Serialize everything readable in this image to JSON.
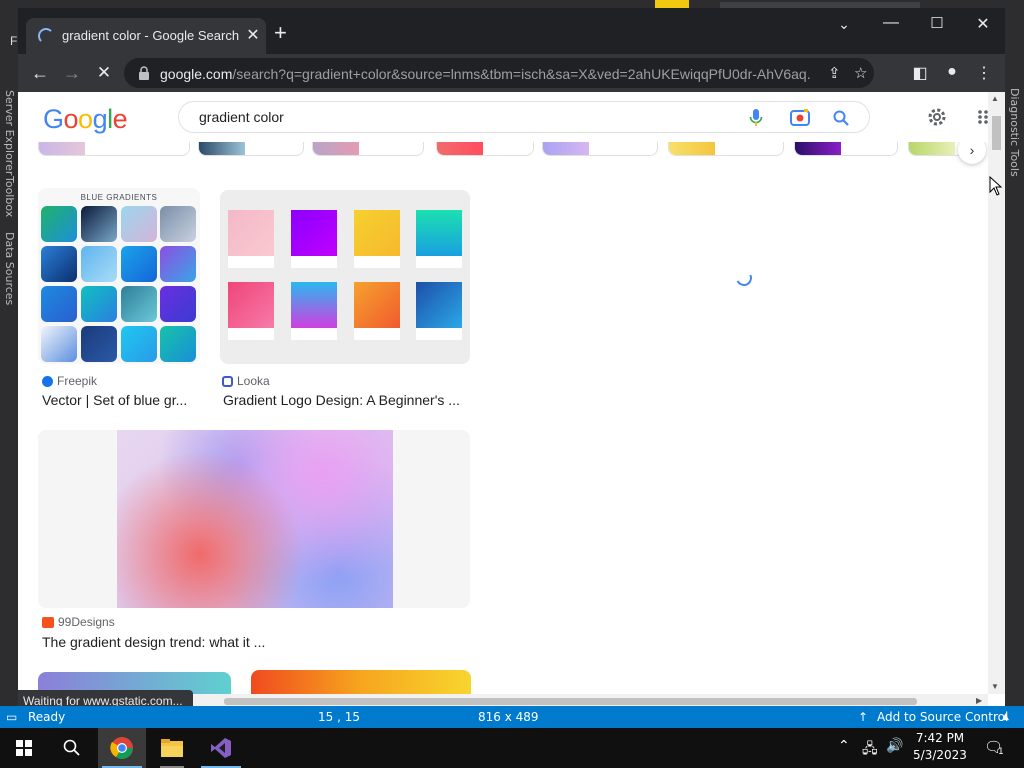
{
  "browser": {
    "tab_title": "gradient color - Google Search",
    "url_host": "google.com",
    "url_path": "/search?q=gradient+color&source=lnms&tbm=isch&sa=X&ved=2ahUKEwiqqPfU0dr-AhV6aq...",
    "status_text": "Waiting for www.gstatic.com..."
  },
  "google": {
    "logo_letters": [
      "G",
      "o",
      "o",
      "g",
      "l",
      "e"
    ],
    "logo_colors": [
      "#4285f4",
      "#ea4335",
      "#fbbc05",
      "#4285f4",
      "#34a853",
      "#ea4335"
    ],
    "search_query": "gradient color"
  },
  "results": [
    {
      "source": "Freepik",
      "caption": "Vector | Set of blue gr...",
      "image_heading": "BLUE GRADIENTS"
    },
    {
      "source": "Looka",
      "caption": "Gradient Logo Design: A Beginner's ..."
    },
    {
      "source": "99Designs",
      "caption": "The gradient design trend: what it ..."
    }
  ],
  "vs_status": {
    "ready": "Ready",
    "position": "15 , 15",
    "size": "816 x 489",
    "source_control": "Add to Source Control"
  },
  "vs_side_left": [
    "Server Explorer",
    "Toolbox",
    "Data Sources"
  ],
  "vs_side_right": "Diagnostic Tools",
  "vs_menu_letter": "Fi",
  "clock": {
    "time": "7:42 PM",
    "date": "5/3/2023"
  },
  "notifications_count": "1",
  "colors": {
    "accent_blue": "#007acc",
    "chrome_dark": "#202124"
  }
}
